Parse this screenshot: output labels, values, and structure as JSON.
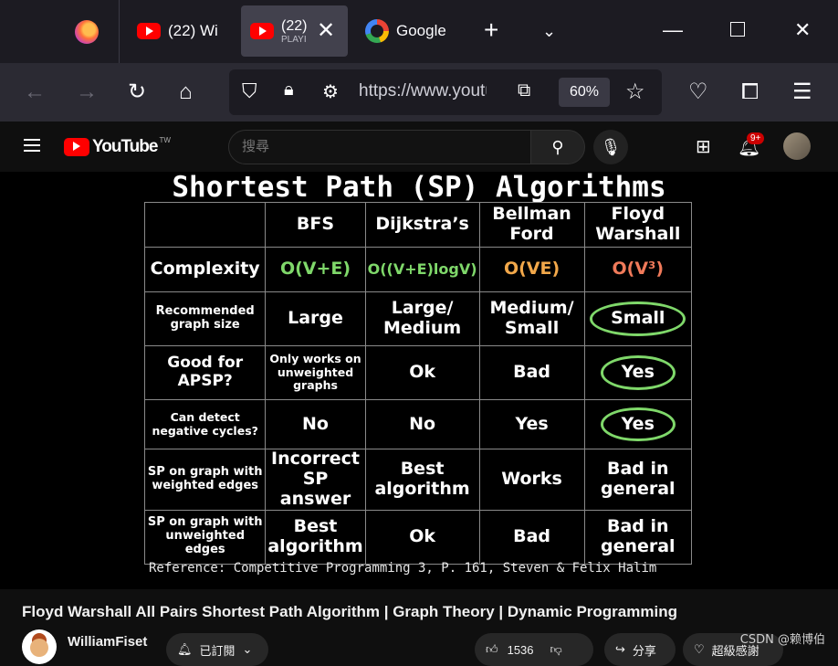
{
  "browser": {
    "tabs": [
      {
        "label": "(22) Wi",
        "active": false
      },
      {
        "label": "(22)",
        "sublabel": "PLAYI",
        "active": true
      },
      {
        "label": "Google",
        "active": false
      }
    ],
    "url": "https://www.youtu",
    "zoom": "60%"
  },
  "youtube": {
    "logo_text": "YouTube",
    "region": "TW",
    "search_placeholder": "搜尋",
    "notification_count": "9+"
  },
  "slide": {
    "title": "Shortest Path (SP) Algorithms",
    "columns": [
      "BFS",
      "Dijkstra’s",
      "Bellman Ford",
      "Floyd Warshall"
    ],
    "complexity_label": "Complexity",
    "complexities": [
      "O(V+E)",
      "O((V+E)logV)",
      "O(VE)",
      "O(V³)"
    ],
    "rows": [
      {
        "label": "Recommended graph size",
        "cells": [
          "Large",
          "Large/ Medium",
          "Medium/ Small",
          "Small"
        ]
      },
      {
        "label": "Good for APSP?",
        "cells": [
          "Only works on unweighted graphs",
          "Ok",
          "Bad",
          "Yes"
        ]
      },
      {
        "label": "Can detect negative cycles?",
        "cells": [
          "No",
          "No",
          "Yes",
          "Yes"
        ]
      },
      {
        "label": "SP on graph with weighted edges",
        "cells": [
          "Incorrect SP answer",
          "Best algorithm",
          "Works",
          "Bad in general"
        ]
      },
      {
        "label": "SP on graph with unweighted edges",
        "cells": [
          "Best algorithm",
          "Ok",
          "Bad",
          "Bad in general"
        ]
      }
    ],
    "reference": "Reference: Competitive Programming 3, P. 161, Steven & Felix Halim",
    "colors": {
      "green": "#7fd86a",
      "orange": "#f2a84a",
      "red": "#f07a5a",
      "grid": "#8a8a8a"
    }
  },
  "video": {
    "title": "Floyd Warshall All Pairs Shortest Path Algorithm | Graph Theory | Dynamic Programming",
    "channel": "WilliamFiset",
    "subscribed_label": "已訂閱",
    "likes": "1536",
    "share_label": "分享",
    "thanks_label": "超級感謝"
  },
  "watermark": "CSDN @赖博伯"
}
